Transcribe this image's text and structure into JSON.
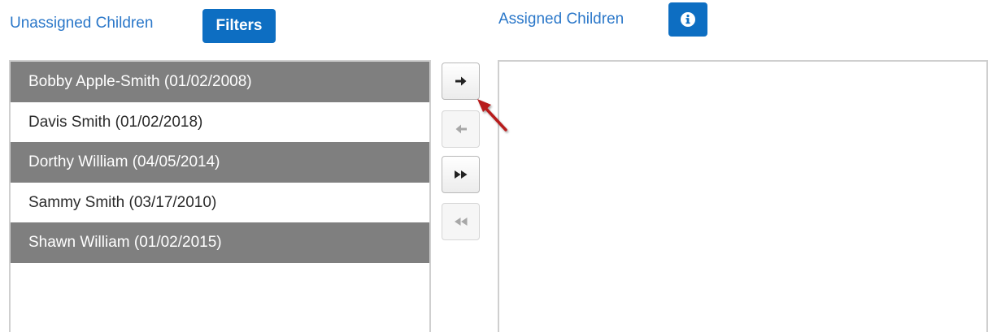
{
  "unassigned": {
    "title": "Unassigned Children",
    "filters_label": "Filters",
    "children": [
      {
        "label": "Bobby Apple-Smith (01/02/2008)"
      },
      {
        "label": "Davis Smith (01/02/2018)"
      },
      {
        "label": "Dorthy William (04/05/2014)"
      },
      {
        "label": "Sammy Smith (03/17/2010)"
      },
      {
        "label": "Shawn William (01/02/2015)"
      }
    ]
  },
  "assigned": {
    "title": "Assigned Children",
    "children": []
  },
  "controls": {
    "move_right": {
      "icon": "arrow-right-icon",
      "enabled": true
    },
    "move_left": {
      "icon": "arrow-left-icon",
      "enabled": false
    },
    "move_all_right": {
      "icon": "double-chevron-right-icon",
      "enabled": true
    },
    "move_all_left": {
      "icon": "double-chevron-left-icon",
      "enabled": false
    }
  },
  "colors": {
    "accent": "#0d6ec2",
    "title_text": "#2a77c9",
    "shaded_row": "#7f7f7f",
    "annotation_arrow": "#b71c1c"
  }
}
